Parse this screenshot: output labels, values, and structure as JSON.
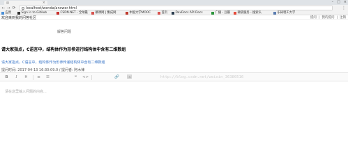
{
  "browser": {
    "tab_title": "",
    "url": "localhost/wenda/answer.html"
  },
  "bookmarks": [
    {
      "label": "应用",
      "color": "#4a90d9"
    },
    {
      "label": "Sign in to GitHub",
      "color": "#333333"
    },
    {
      "label": "CSDN.NET - 全球最",
      "color": "#c9302c"
    },
    {
      "label": "慕课网 | 集成网",
      "color": "#d9534f"
    },
    {
      "label": "中国大学MOOC",
      "color": "#c0392b"
    },
    {
      "label": "首页",
      "color": "#d9534f"
    },
    {
      "label": "DevDocs API Docs",
      "color": "#2c3e50"
    },
    {
      "label": "广播 - 豆瓣",
      "color": "#2e963d"
    },
    {
      "label": "微软服务 - 搜索头",
      "color": "#e74c3c"
    },
    {
      "label": "乐知理工大学",
      "color": "#5b7db1"
    }
  ],
  "site": {
    "welcome": "欢迎来到我的问答社区",
    "links": [
      "提问",
      "我的提问",
      "注销"
    ]
  },
  "breadcrumb": "解答问题",
  "question": {
    "title": "请大家指点，C语言中，结构体作为形参进行结构体中含有二维数组",
    "body": "请大家指点，C语言中，结构体作为形参传递结构体中含有二维数组",
    "meta": "提问时间: 2017-04-13 16:30:09.0 / 提问者: 阿木律"
  },
  "toolbar": {
    "bold": "B",
    "italic": "I",
    "heading": "H",
    "list": "≡",
    "ordered_list": "☰",
    "quote": "❝",
    "code": "<>",
    "link": "🔗",
    "image": "🖼",
    "watermark": "http://blog.csdn.net/weixin_36380516"
  },
  "editor": {
    "placeholder": "请在这里输入问题的内容..."
  }
}
